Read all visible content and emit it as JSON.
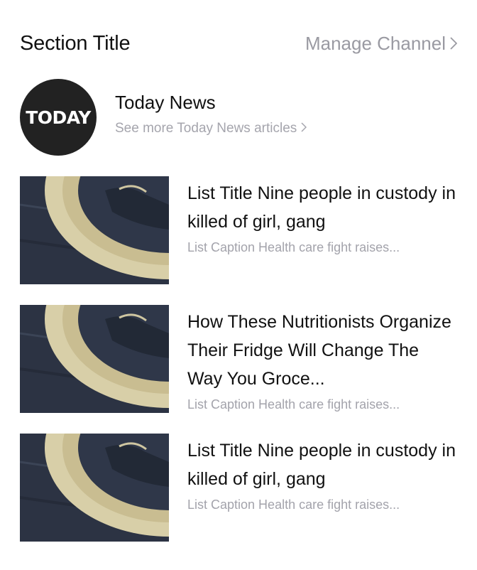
{
  "header": {
    "section_title": "Section Title",
    "manage_label": "Manage Channel"
  },
  "channel": {
    "logo_text": "TODAY",
    "name": "Today News",
    "more_label": "See more Today News articles"
  },
  "articles": [
    {
      "title": "List Title Nine people in custody in killed of girl, gang",
      "caption": "List Caption Health care fight raises..."
    },
    {
      "title": "How These Nutritionists Organize Their Fridge Will Change The Way You Groce...",
      "caption": "List Caption Health care fight raises..."
    },
    {
      "title": "List Title Nine people in custody in killed of girl, gang",
      "caption": "List Caption Health care fight raises..."
    }
  ],
  "colors": {
    "text_primary": "#111111",
    "text_secondary": "#9a9aa2",
    "logo_bg": "#222222"
  }
}
